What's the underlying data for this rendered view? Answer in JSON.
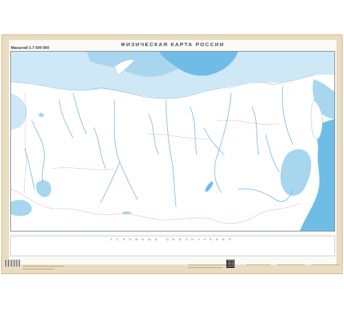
{
  "map": {
    "title": "ФИЗИЧЕСКАЯ КАРТА РОССИИ",
    "scale": "Масштаб 1:7 500 000",
    "legend_title": "УСЛОВНЫЕ ОБОЗНАЧЕНИЯ",
    "colors": {
      "land": "#ffffff",
      "shallow_sea": "#cfe8f6",
      "medium_sea": "#a9d6ef",
      "deep_sea": "#6fbde6",
      "rivers": "#69aedc",
      "borders": "#d7a59c",
      "frame": "#e9dcc0"
    }
  },
  "footer": {
    "text_blocks": [
      "",
      "",
      "",
      ""
    ]
  }
}
